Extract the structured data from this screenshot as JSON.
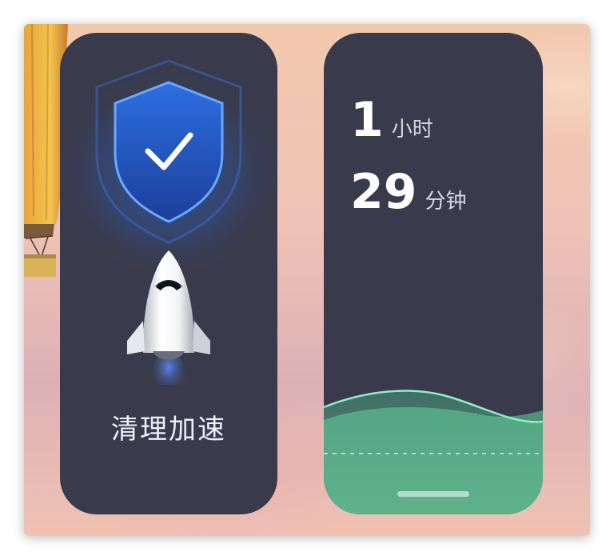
{
  "widgets": {
    "clean": {
      "label": "清理加速",
      "icons": [
        "shield-check-icon",
        "rocket-icon"
      ]
    },
    "battery": {
      "hours_value": "1",
      "hours_unit": "小时",
      "minutes_value": "29",
      "minutes_unit": "分钟",
      "wave_color": "#6fd6a0"
    }
  },
  "colors": {
    "widget_bg": "#393b4d",
    "shield_blue": "#2f7ef0",
    "wave_green": "#6fd6a0"
  }
}
